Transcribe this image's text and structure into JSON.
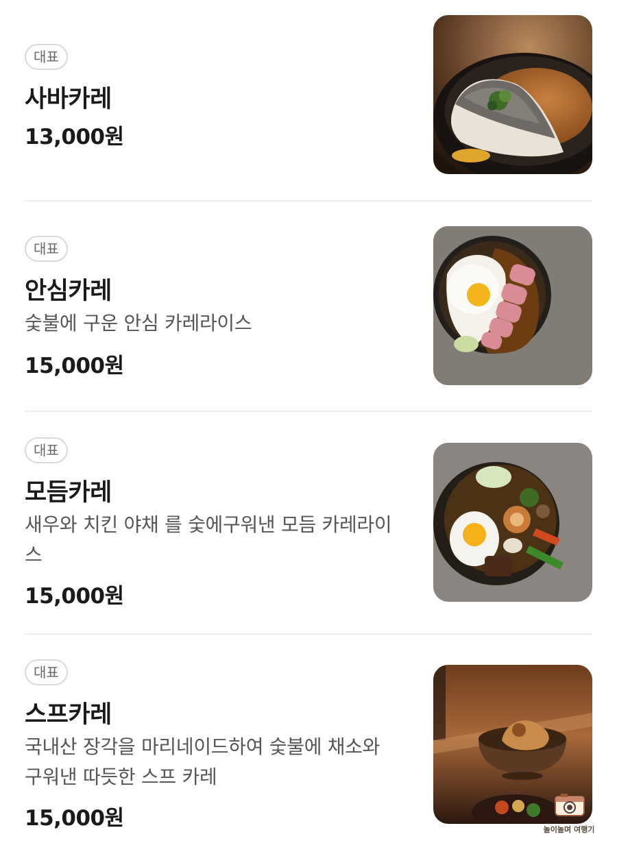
{
  "menu": {
    "items": [
      {
        "badge": "대표",
        "name": "사바카레",
        "description": "",
        "price": "13,000원",
        "image_icon": "curry-mackerel-photo"
      },
      {
        "badge": "대표",
        "name": "안심카레",
        "description": "숯불에 구운 안심 카레라이스",
        "price": "15,000원",
        "image_icon": "curry-tenderloin-photo"
      },
      {
        "badge": "대표",
        "name": "모듬카레",
        "description": "새우와 치킨 야채 를 숯에구워낸 모듬 카레라이스",
        "price": "15,000원",
        "image_icon": "curry-assorted-photo"
      },
      {
        "badge": "대표",
        "name": "스프카레",
        "description": "국내산 장각을 마리네이드하여 숯불에 채소와 구워낸 따듯한 스프 카레",
        "price": "15,000원",
        "image_icon": "soup-curry-photo"
      }
    ]
  },
  "watermark": {
    "text": "놀이놀며 여행기",
    "icon": "camera-icon"
  }
}
